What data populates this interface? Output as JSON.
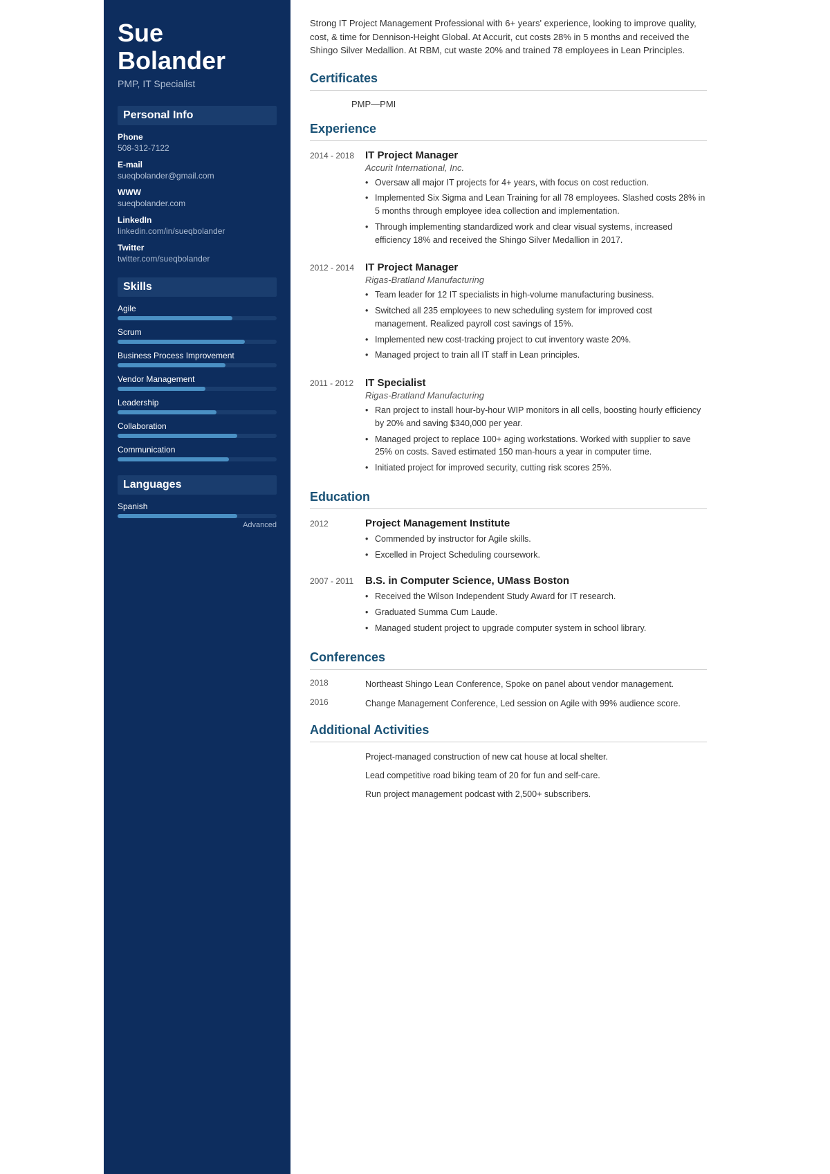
{
  "sidebar": {
    "name": "Sue Bolander",
    "title": "PMP, IT Specialist",
    "personal_info": {
      "section_title": "Personal Info",
      "phone_label": "Phone",
      "phone_value": "508-312-7122",
      "email_label": "E-mail",
      "email_value": "sueqbolander@gmail.com",
      "www_label": "WWW",
      "www_value": "sueqbolander.com",
      "linkedin_label": "LinkedIn",
      "linkedin_value": "linkedin.com/in/sueqbolander",
      "twitter_label": "Twitter",
      "twitter_value": "twitter.com/sueqbolander"
    },
    "skills": {
      "section_title": "Skills",
      "items": [
        {
          "name": "Agile",
          "percent": 72
        },
        {
          "name": "Scrum",
          "percent": 80
        },
        {
          "name": "Business Process Improvement",
          "percent": 68
        },
        {
          "name": "Vendor Management",
          "percent": 55
        },
        {
          "name": "Leadership",
          "percent": 62
        },
        {
          "name": "Collaboration",
          "percent": 75
        },
        {
          "name": "Communication",
          "percent": 70
        }
      ]
    },
    "languages": {
      "section_title": "Languages",
      "items": [
        {
          "name": "Spanish",
          "percent": 75,
          "level": "Advanced"
        }
      ]
    }
  },
  "main": {
    "summary": "Strong IT Project Management Professional with 6+ years' experience, looking to improve quality, cost, & time for Dennison-Height Global. At Accurit, cut costs 28% in 5 months and received the Shingo Silver Medallion. At RBM, cut waste 20% and trained 78 employees in Lean Principles.",
    "certificates": {
      "section_title": "Certificates",
      "items": [
        {
          "value": "PMP—PMI"
        }
      ]
    },
    "experience": {
      "section_title": "Experience",
      "items": [
        {
          "years": "2014 - 2018",
          "job_title": "IT Project Manager",
          "company": "Accurit International, Inc.",
          "bullets": [
            "Oversaw all major IT projects for 4+ years, with focus on cost reduction.",
            "Implemented Six Sigma and Lean Training for all 78 employees. Slashed costs 28% in 5 months through employee idea collection and implementation.",
            "Through implementing standardized work and clear visual systems, increased efficiency 18% and received the Shingo Silver Medallion in 2017."
          ]
        },
        {
          "years": "2012 - 2014",
          "job_title": "IT Project Manager",
          "company": "Rigas-Bratland Manufacturing",
          "bullets": [
            "Team leader for 12 IT specialists in high-volume manufacturing business.",
            "Switched all 235 employees to new scheduling system for improved cost management. Realized payroll cost savings of 15%.",
            "Implemented new cost-tracking project to cut inventory waste 20%.",
            "Managed project to train all IT staff in Lean principles."
          ]
        },
        {
          "years": "2011 - 2012",
          "job_title": "IT Specialist",
          "company": "Rigas-Bratland Manufacturing",
          "bullets": [
            "Ran project to install hour-by-hour WIP monitors in all cells, boosting hourly efficiency by 20% and saving $340,000 per year.",
            "Managed project to replace 100+ aging workstations. Worked with supplier to save 25% on costs. Saved estimated 150 man-hours a year in computer time.",
            "Initiated project for improved security, cutting risk scores 25%."
          ]
        }
      ]
    },
    "education": {
      "section_title": "Education",
      "items": [
        {
          "years": "2012",
          "institution": "Project Management Institute",
          "bullets": [
            "Commended by instructor for Agile skills.",
            "Excelled in Project Scheduling coursework."
          ]
        },
        {
          "years": "2007 - 2011",
          "institution": "B.S. in Computer Science, UMass Boston",
          "bullets": [
            "Received the Wilson Independent Study Award for IT research.",
            "Graduated Summa Cum Laude.",
            "Managed student project to upgrade computer system in school library."
          ]
        }
      ]
    },
    "conferences": {
      "section_title": "Conferences",
      "items": [
        {
          "year": "2018",
          "desc": "Northeast Shingo Lean Conference, Spoke on panel about vendor management."
        },
        {
          "year": "2016",
          "desc": "Change Management Conference, Led session on Agile with 99% audience score."
        }
      ]
    },
    "additional_activities": {
      "section_title": "Additional Activities",
      "items": [
        "Project-managed construction of new cat house at local shelter.",
        "Lead competitive road biking team of 20 for fun and self-care.",
        "Run project management podcast with 2,500+ subscribers."
      ]
    }
  }
}
